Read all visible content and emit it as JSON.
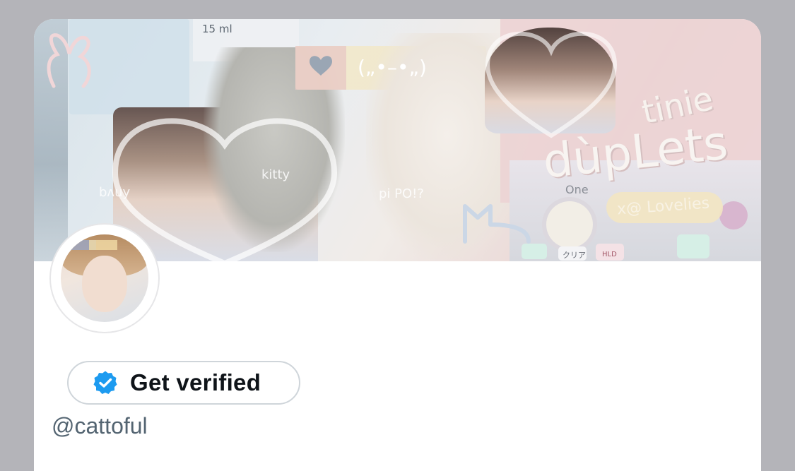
{
  "profile": {
    "get_verified_label": "Get verified",
    "handle": "@cattoful"
  },
  "banner": {
    "caption_tinie": "tinie",
    "caption_duplets": "dùpLets",
    "caption_lovelies": "x@ Lovelies",
    "caption_bunny": "bʌuy",
    "caption_kitty": "kitty",
    "caption_pipo": "pi PO!?",
    "caption_kaomoji": "(„•–•„)",
    "caption_bottle": "15 ml",
    "caption_phone_brand": "One",
    "caption_phone_clear": "クリア",
    "caption_phone_hold": "HLD"
  },
  "colors": {
    "background": "#b4b4b9",
    "card": "#ffffff",
    "verified_badge": "#1d9bf0",
    "text_primary": "#0f1419",
    "text_secondary": "#536471"
  },
  "icons": {
    "verified_badge": "verified-badge-icon"
  }
}
